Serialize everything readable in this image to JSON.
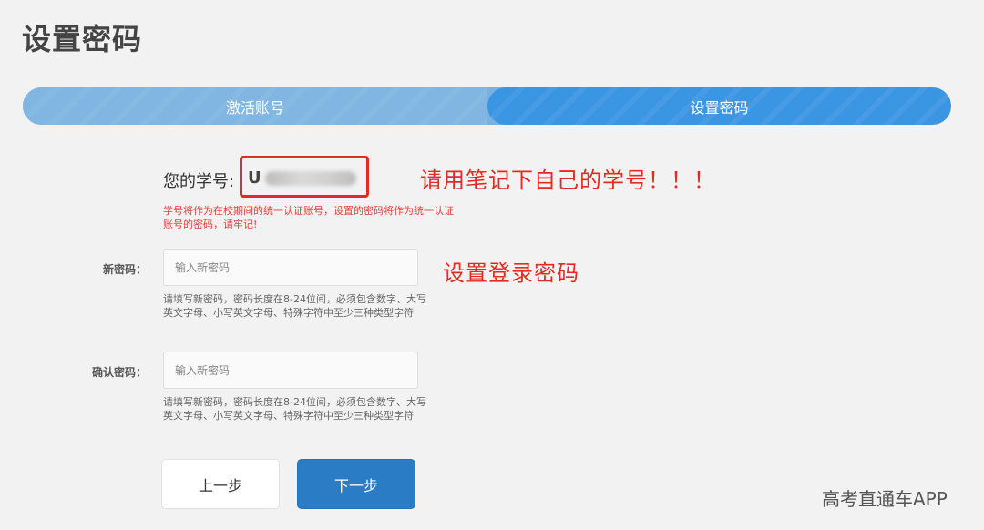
{
  "page": {
    "title": "设置密码"
  },
  "steps": [
    {
      "label": "激活账号"
    },
    {
      "label": "设置密码"
    }
  ],
  "student_id": {
    "label": "您的学号:",
    "visible_prefix": "U",
    "note": "学号将作为在校期间的统一认证账号，设置的密码将作为统一认证账号的密码，请牢记!"
  },
  "annotations": {
    "remember_id": "请用笔记下自己的学号！！！",
    "set_password": "设置登录密码"
  },
  "form": {
    "new_password": {
      "label": "新密码：",
      "placeholder": "输入新密码",
      "hint": "请填写新密码，密码长度在8-24位间，必须包含数字、大写英文字母、小写英文字母、特殊字符中至少三种类型字符"
    },
    "confirm_password": {
      "label": "确认密码：",
      "placeholder": "输入新密码",
      "hint": "请填写新密码，密码长度在8-24位间，必须包含数字、大写英文字母、小写英文字母、特殊字符中至少三种类型字符"
    }
  },
  "buttons": {
    "prev": "上一步",
    "next": "下一步"
  },
  "watermark": "高考直通车APP",
  "colors": {
    "accent": "#2a7dc4",
    "annotation_red": "#e52a22",
    "step_active": "#3a95e3",
    "step_done": "#80b6e1"
  }
}
